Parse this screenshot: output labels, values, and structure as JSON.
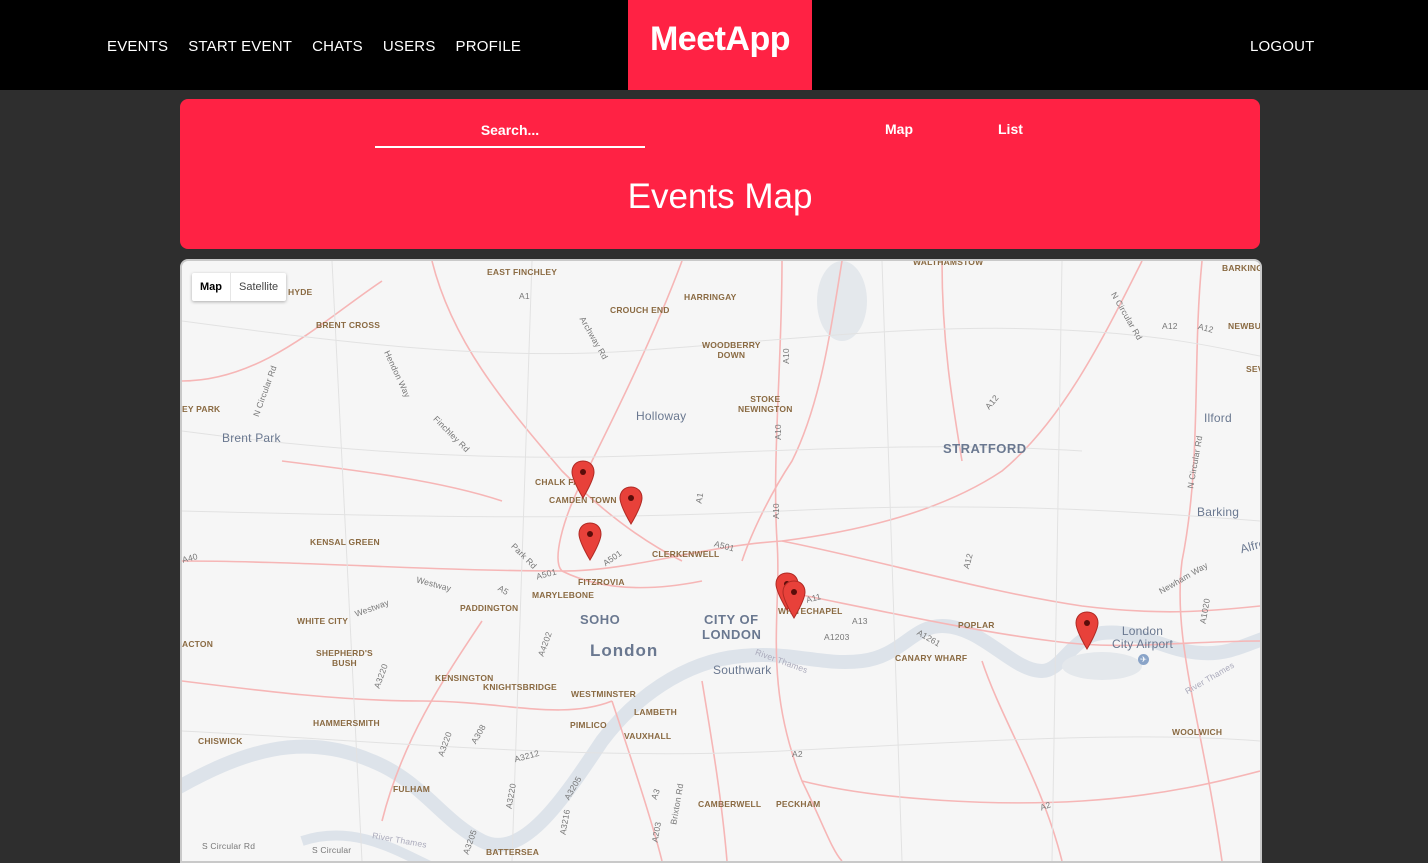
{
  "nav": {
    "links": [
      "EVENTS",
      "START EVENT",
      "CHATS",
      "USERS",
      "PROFILE"
    ],
    "brand": "MeetApp",
    "logout": "LOGOUT"
  },
  "header": {
    "search_placeholder": "Search...",
    "view_map": "Map",
    "view_list": "List",
    "title": "Events Map"
  },
  "map": {
    "type_map": "Map",
    "type_satellite": "Satellite",
    "labels": {
      "east_finchley": "EAST FINCHLEY",
      "walthamstow": "WALTHAMSTOW",
      "barkingside": "BARKINGSIDE",
      "hyde": "HYDE",
      "a1_top": "A1",
      "harringay": "HARRINGAY",
      "crouch_end": "CROUCH END",
      "archway_rd": "Archway Rd",
      "brent_cross": "BRENT CROSS",
      "n_circular_rd_right": "N Circular Rd",
      "a12_top": "A12",
      "a12_right": "A12",
      "newbury": "NEWBU",
      "hendon_way": "Hendon Way",
      "woodberry_down": "WOODBERRY\nDOWN",
      "a10_top": "A10",
      "sev": "SEV",
      "n_circular_rd_left": "N Circular Rd",
      "stoke_newington": "STOKE\nNEWINGTON",
      "a12_mid": "A12",
      "ley_park": "EY PARK",
      "holloway": "Holloway",
      "ilford": "Ilford",
      "brent_park": "Brent Park",
      "finchley_rd": "Finchley Rd",
      "a10_mid": "A10",
      "stratford": "STRATFORD",
      "n_circular_rd_far": "N Circular Rd",
      "chalk_farm": "CHALK FA",
      "camden_town": "CAMDEN TOWN",
      "a1_mid": "A1",
      "barking": "Barking",
      "a10_low": "A10",
      "kensal_green": "KENSAL GREEN",
      "park_rd": "Park Rd",
      "a501_a": "A501",
      "a501_b": "A501",
      "clerkenwell": "CLERKENWELL",
      "a12_low": "A12",
      "alfre": "Alfre",
      "a40": "A40",
      "westway_a": "Westway",
      "a501_c": "A501",
      "fitzrovia": "FITZROVIA",
      "a5": "A5",
      "newham_way": "Newham Way",
      "marylebone": "MARYLEBONE",
      "a11": "A11",
      "westway_b": "Westway",
      "paddington": "PADDINGTON",
      "whitechapel": "WHITECHAPEL",
      "a1020": "A1020",
      "white_city": "WHITE CITY",
      "soho": "SOHO",
      "city_of": "CITY OF",
      "london_city": "LONDON",
      "a13": "A13",
      "poplar": "POPLAR",
      "acton": "ACTON",
      "a4202": "A4202",
      "a1203": "A1203",
      "a1261": "A1261",
      "london_city_airport": "London\nCity Airport",
      "london": "London",
      "shepherds_bush": "SHEPHERD'S\nBUSH",
      "southwark": "Southwark",
      "canary_wharf": "CANARY WHARF",
      "kensington": "KENSINGTON",
      "a3220_a": "A3220",
      "knightsbridge": "KNIGHTSBRIDGE",
      "westminster": "WESTMINSTER",
      "river_thames_a": "River Thames",
      "river_thames_east": "River Thames",
      "hammersmith": "HAMMERSMITH",
      "pimlico": "PIMLICO",
      "lambeth": "LAMBETH",
      "a308": "A308",
      "woolwich": "WOOLWICH",
      "chiswick": "CHISWICK",
      "vauxhall": "VAUXHALL",
      "a3220_b": "A3220",
      "a3212": "A3212",
      "a2": "A2",
      "fulham": "FULHAM",
      "a3205": "A3205",
      "a3": "A3",
      "brixton_rd": "Brixton Rd",
      "a3220_c": "A3220",
      "camberwell": "CAMBERWELL",
      "peckham": "PECKHAM",
      "a2_low": "A2",
      "a3216": "A3216",
      "a203": "A203",
      "s_circular_rd_a": "S Circular Rd",
      "s_circular_rd_b": "S Circular",
      "river_thames_sw": "River Thames",
      "a3205_b": "A3205",
      "battersea": "BATTERSEA"
    }
  },
  "colors": {
    "brand": "#ff2244",
    "nav_bg": "#000000",
    "page_bg": "#2e2e2e",
    "marker": "#e8413a"
  }
}
